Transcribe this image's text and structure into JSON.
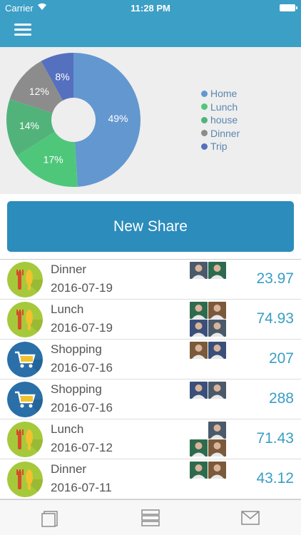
{
  "status": {
    "carrier": "Carrier",
    "time": "11:28 PM"
  },
  "colors": {
    "home": "#6397cf",
    "lunch": "#4fc77b",
    "house": "#52b37a",
    "dinner": "#8c8c8c",
    "trip": "#5670c0",
    "accent": "#3c9fc6"
  },
  "chart_data": {
    "type": "pie",
    "slices": [
      {
        "name": "Home",
        "value": 49,
        "label": "49%",
        "color": "#6397cf"
      },
      {
        "name": "Lunch",
        "value": 17,
        "label": "17%",
        "color": "#4fc77b"
      },
      {
        "name": "house",
        "value": 14,
        "label": "14%",
        "color": "#52b37a"
      },
      {
        "name": "Dinner",
        "value": 12,
        "label": "12%",
        "color": "#8c8c8c"
      },
      {
        "name": "Trip",
        "value": 8,
        "label": "8%",
        "color": "#5670c0"
      }
    ],
    "legend": [
      "Home",
      "Lunch",
      "house",
      "Dinner",
      "Trip"
    ]
  },
  "new_share_label": "New Share",
  "shares": [
    {
      "title": "Dinner",
      "date": "2016-07-19",
      "amount": "23.97",
      "icon": "fork-knife-icon",
      "avatars": 2
    },
    {
      "title": "Lunch",
      "date": "2016-07-19",
      "amount": "74.93",
      "icon": "fork-knife-icon",
      "avatars": 4
    },
    {
      "title": "Shopping",
      "date": "2016-07-16",
      "amount": "207",
      "icon": "shopping-cart-icon",
      "avatars": 2
    },
    {
      "title": "Shopping",
      "date": "2016-07-16",
      "amount": "288",
      "icon": "shopping-cart-icon",
      "avatars": 2
    },
    {
      "title": "Lunch",
      "date": "2016-07-12",
      "amount": "71.43",
      "icon": "fork-knife-icon",
      "avatars": 3
    },
    {
      "title": "Dinner",
      "date": "2016-07-11",
      "amount": "43.12",
      "icon": "fork-knife-icon",
      "avatars": 2
    }
  ],
  "tabs": [
    {
      "icon": "cards-icon"
    },
    {
      "icon": "server-list-icon"
    },
    {
      "icon": "mail-icon"
    }
  ]
}
